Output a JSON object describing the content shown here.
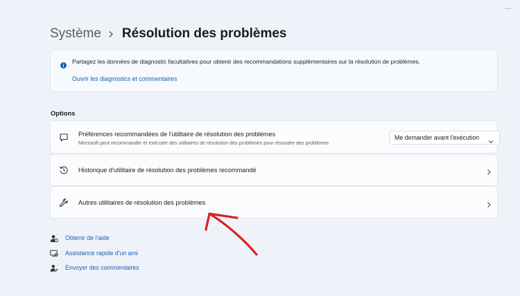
{
  "window": {
    "controls": "..."
  },
  "breadcrumb": {
    "root": "Système",
    "separator_icon": "chevron-right-icon",
    "current": "Résolution des problèmes"
  },
  "info_card": {
    "icon": "info-icon",
    "text": "Partagez les données de diagnostic facultatives pour obtenir des recommandations supplémentaires sur la résolution de problèmes.",
    "link": "Ouvrir les diagnostics et commentaires"
  },
  "options": {
    "label": "Options",
    "rows": [
      {
        "icon": "chat-bubble-icon",
        "title": "Préférences recommandées de l'utilitaire de résolution des problèmes",
        "description": "Microsoft peut recommander et exécuter des utilitaires de résolution des problèmes pour résoudre des problèmes",
        "dropdown_value": "Me demander avant l'exécution"
      },
      {
        "icon": "history-icon",
        "title": "Historique d'utilitaire de résolution des problèmes recommandé"
      },
      {
        "icon": "wrench-icon",
        "title": "Autres utilitaires de résolution des problèmes"
      }
    ]
  },
  "help_links": [
    {
      "icon": "help-person-icon",
      "label": "Obtenir de l'aide"
    },
    {
      "icon": "quick-assist-icon",
      "label": "Assistance rapide d'un ami"
    },
    {
      "icon": "feedback-icon",
      "label": "Envoyer des commentaires"
    }
  ],
  "colors": {
    "background": "#eff3f9",
    "card": "#fbfcfe",
    "link": "#1a5fb4",
    "accent_info": "#1a5fb4",
    "annotation_arrow": "#d9231f"
  }
}
